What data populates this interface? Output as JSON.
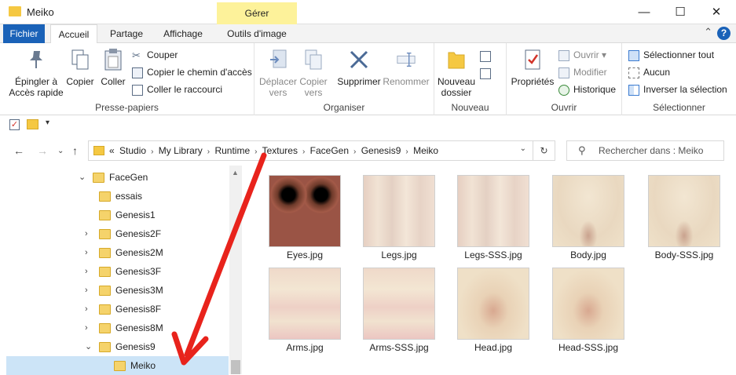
{
  "window": {
    "title": "Meiko",
    "contextual_tab": "Gérer",
    "minimize": "—",
    "maximize": "☐",
    "close": "✕"
  },
  "tabs": [
    "Fichier",
    "Accueil",
    "Partage",
    "Affichage",
    "Outils d'image"
  ],
  "ribbon": {
    "presse_papiers": {
      "label": "Presse-papiers",
      "pin": [
        "Épingler à",
        "Accès rapide"
      ],
      "copier": "Copier",
      "coller": "Coller",
      "couper": "Couper",
      "copier_chemin": "Copier le chemin d'accès",
      "coller_raccourci": "Coller le raccourci"
    },
    "organiser": {
      "label": "Organiser",
      "deplacer": [
        "Déplacer",
        "vers"
      ],
      "copier_vers": [
        "Copier",
        "vers"
      ],
      "supprimer": "Supprimer",
      "renommer": "Renommer"
    },
    "nouveau": {
      "label": "Nouveau",
      "nouveau_dossier": [
        "Nouveau",
        "dossier"
      ]
    },
    "ouvrir": {
      "label": "Ouvrir",
      "proprietes": "Propriétés",
      "ouvrir": "Ouvrir",
      "modifier": "Modifier",
      "historique": "Historique"
    },
    "selectionner": {
      "label": "Sélectionner",
      "tout": "Sélectionner tout",
      "aucun": "Aucun",
      "inverser": "Inverser la sélection"
    }
  },
  "address": {
    "prefix": "«",
    "crumbs": [
      "Studio",
      "My Library",
      "Runtime",
      "Textures",
      "FaceGen",
      "Genesis9",
      "Meiko"
    ]
  },
  "search": {
    "placeholder": "Rechercher dans : Meiko"
  },
  "tree": [
    {
      "label": "FaceGen",
      "chevron": "⌄",
      "level": 0
    },
    {
      "label": "essais",
      "chevron": "",
      "level": 1
    },
    {
      "label": "Genesis1",
      "chevron": "",
      "level": 1
    },
    {
      "label": "Genesis2F",
      "chevron": "›",
      "level": 1
    },
    {
      "label": "Genesis2M",
      "chevron": "›",
      "level": 1
    },
    {
      "label": "Genesis3F",
      "chevron": "›",
      "level": 1
    },
    {
      "label": "Genesis3M",
      "chevron": "›",
      "level": 1
    },
    {
      "label": "Genesis8F",
      "chevron": "›",
      "level": 1
    },
    {
      "label": "Genesis8M",
      "chevron": "›",
      "level": 1
    },
    {
      "label": "Genesis9",
      "chevron": "⌄",
      "level": 1
    },
    {
      "label": "Meiko",
      "chevron": "",
      "level": 2,
      "selected": true
    }
  ],
  "files": [
    {
      "name": "Eyes.jpg",
      "kind": "eyes"
    },
    {
      "name": "Legs.jpg",
      "kind": "legs"
    },
    {
      "name": "Legs-SSS.jpg",
      "kind": "legs"
    },
    {
      "name": "Body.jpg",
      "kind": "body"
    },
    {
      "name": "Body-SSS.jpg",
      "kind": "body"
    },
    {
      "name": "Arms.jpg",
      "kind": "arms"
    },
    {
      "name": "Arms-SSS.jpg",
      "kind": "arms"
    },
    {
      "name": "Head.jpg",
      "kind": "head"
    },
    {
      "name": "Head-SSS.jpg",
      "kind": "head"
    }
  ],
  "colors": {
    "accent": "#1a62b8",
    "contextual": "#fdf29a",
    "selection": "#cce4f7",
    "annotation_arrow": "#e8231c"
  }
}
